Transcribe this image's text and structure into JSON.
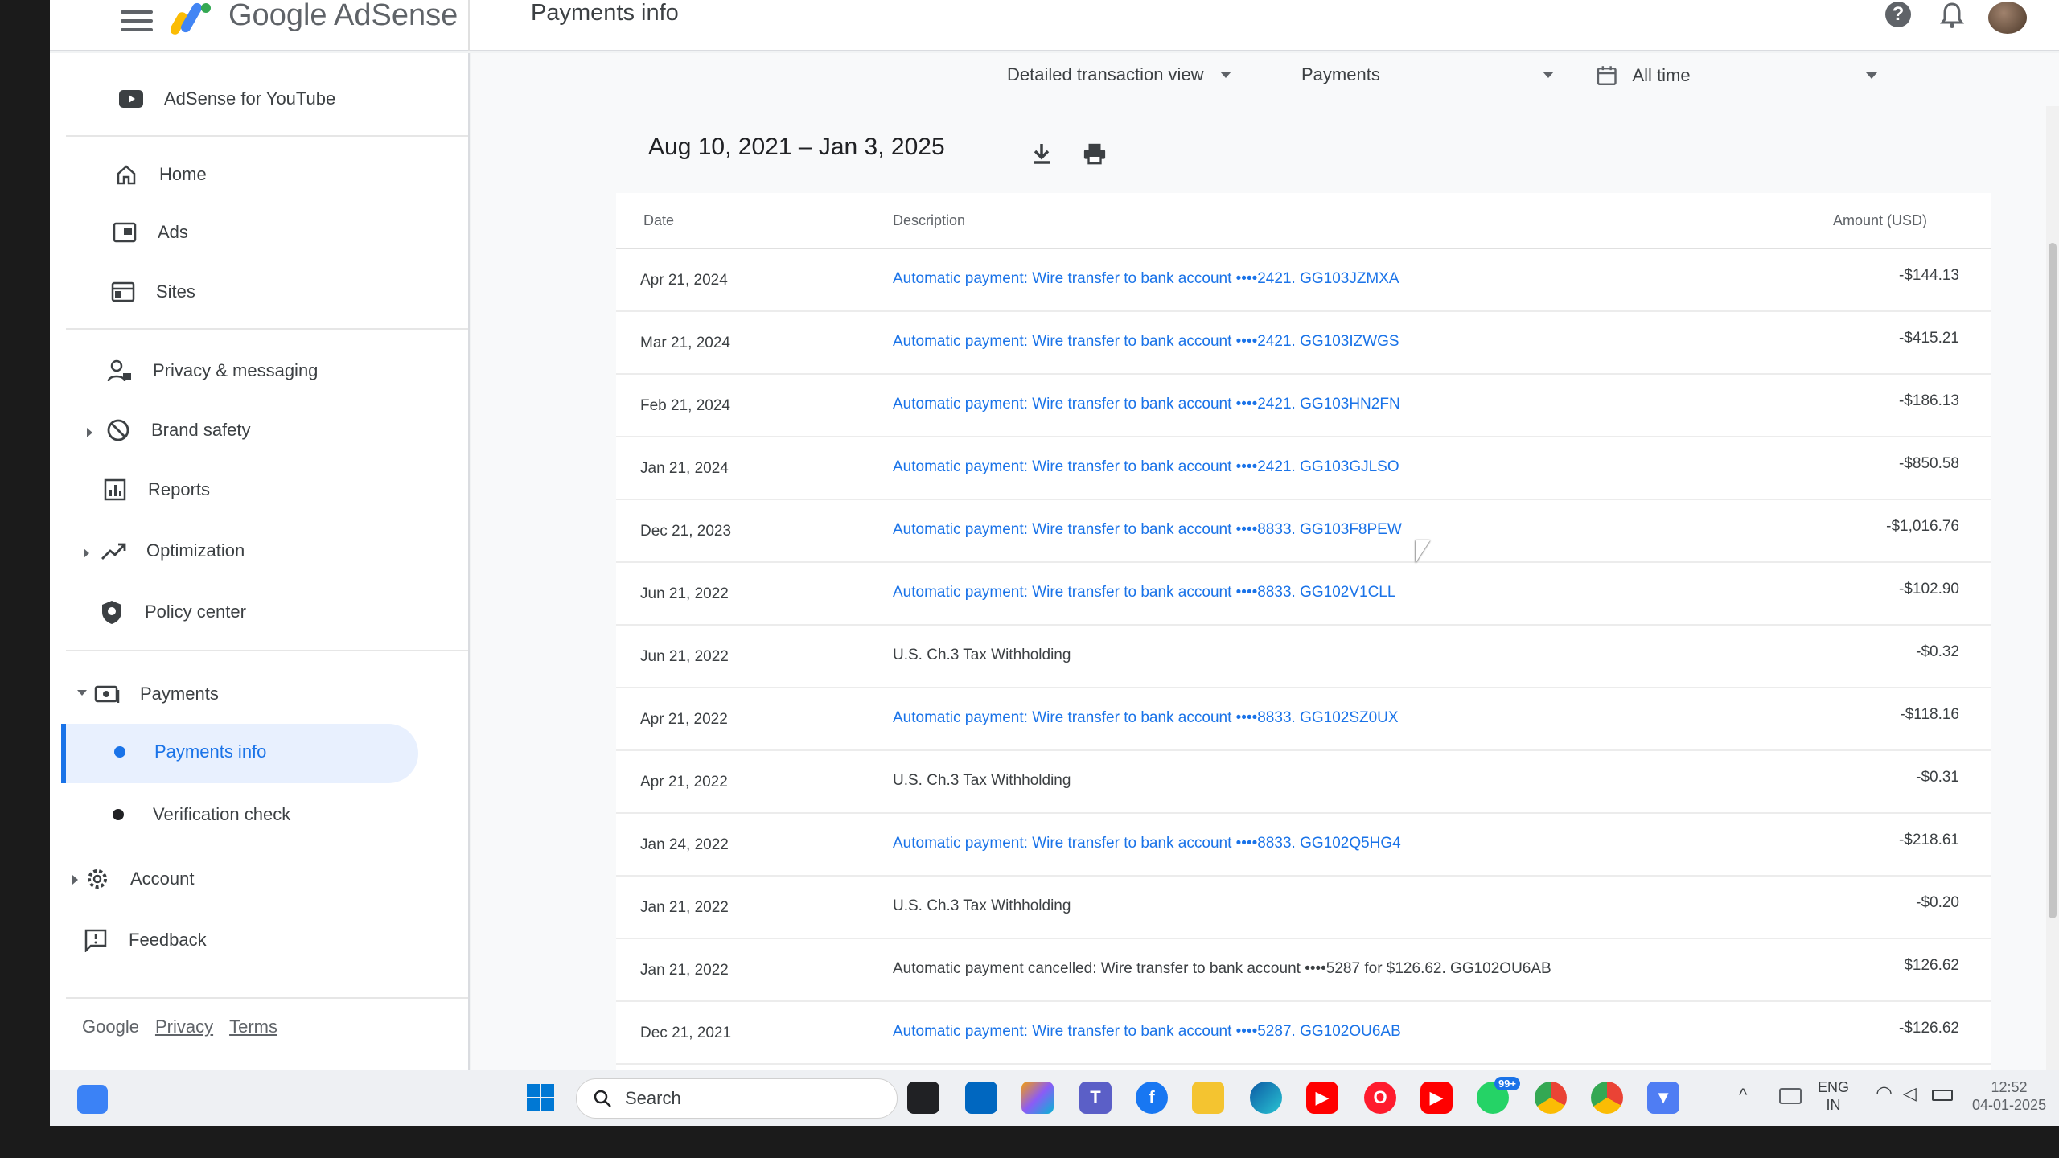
{
  "header": {
    "brand": "Google AdSense",
    "page_title": "Payments info"
  },
  "sidebar": {
    "youtube": "AdSense for YouTube",
    "items": [
      {
        "label": "Home",
        "icon": "home-icon"
      },
      {
        "label": "Ads",
        "icon": "ads-icon"
      },
      {
        "label": "Sites",
        "icon": "sites-icon"
      },
      {
        "label": "Privacy & messaging",
        "icon": "privacy-icon"
      },
      {
        "label": "Brand safety",
        "icon": "block-icon"
      },
      {
        "label": "Reports",
        "icon": "bar-chart-icon"
      },
      {
        "label": "Optimization",
        "icon": "trending-up-icon"
      },
      {
        "label": "Policy center",
        "icon": "shield-icon"
      },
      {
        "label": "Payments",
        "icon": "payments-icon"
      },
      {
        "label": "Payments info",
        "icon": "dot-icon"
      },
      {
        "label": "Verification check",
        "icon": "dot-icon"
      },
      {
        "label": "Account",
        "icon": "gear-icon"
      },
      {
        "label": "Feedback",
        "icon": "feedback-icon"
      }
    ],
    "footer": {
      "google": "Google",
      "privacy": "Privacy",
      "terms": "Terms"
    }
  },
  "filters": {
    "view": "Detailed transaction view",
    "type": "Payments",
    "range": "All time"
  },
  "report": {
    "date_range": "Aug 10, 2021 – Jan 3, 2025",
    "columns": {
      "date": "Date",
      "description": "Description",
      "amount": "Amount (USD)"
    },
    "rows": [
      {
        "date": "Apr 21, 2024",
        "description": "Automatic payment: Wire transfer to bank account ••••2421. GG103JZMXA",
        "amount": "-$144.13",
        "link": true
      },
      {
        "date": "Mar 21, 2024",
        "description": "Automatic payment: Wire transfer to bank account ••••2421. GG103IZWGS",
        "amount": "-$415.21",
        "link": true
      },
      {
        "date": "Feb 21, 2024",
        "description": "Automatic payment: Wire transfer to bank account ••••2421. GG103HN2FN",
        "amount": "-$186.13",
        "link": true
      },
      {
        "date": "Jan 21, 2024",
        "description": "Automatic payment: Wire transfer to bank account ••••2421. GG103GJLSO",
        "amount": "-$850.58",
        "link": true
      },
      {
        "date": "Dec 21, 2023",
        "description": "Automatic payment: Wire transfer to bank account ••••8833. GG103F8PEW",
        "amount": "-$1,016.76",
        "link": true
      },
      {
        "date": "Jun 21, 2022",
        "description": "Automatic payment: Wire transfer to bank account ••••8833. GG102V1CLL",
        "amount": "-$102.90",
        "link": true
      },
      {
        "date": "Jun 21, 2022",
        "description": "U.S. Ch.3 Tax Withholding",
        "amount": "-$0.32",
        "link": false
      },
      {
        "date": "Apr 21, 2022",
        "description": "Automatic payment: Wire transfer to bank account ••••8833. GG102SZ0UX",
        "amount": "-$118.16",
        "link": true
      },
      {
        "date": "Apr 21, 2022",
        "description": "U.S. Ch.3 Tax Withholding",
        "amount": "-$0.31",
        "link": false
      },
      {
        "date": "Jan 24, 2022",
        "description": "Automatic payment: Wire transfer to bank account ••••8833. GG102Q5HG4",
        "amount": "-$218.61",
        "link": true
      },
      {
        "date": "Jan 21, 2022",
        "description": "U.S. Ch.3 Tax Withholding",
        "amount": "-$0.20",
        "link": false
      },
      {
        "date": "Jan 21, 2022",
        "description": "Automatic payment cancelled: Wire transfer to bank account ••••5287 for $126.62. GG102OU6AB",
        "amount": "$126.62",
        "link": false
      },
      {
        "date": "Dec 21, 2021",
        "description": "Automatic payment: Wire transfer to bank account ••••5287. GG102OU6AB",
        "amount": "-$126.62",
        "link": true
      }
    ]
  },
  "taskbar": {
    "search_placeholder": "Search",
    "whatsapp_badge": "99+",
    "lang_top": "ENG",
    "lang_bottom": "IN",
    "time": "12:52",
    "date": "04-01-2025"
  },
  "colors": {
    "accent": "#1a73e8",
    "link": "#1a73e8",
    "active_bg": "#e8f0fe"
  }
}
